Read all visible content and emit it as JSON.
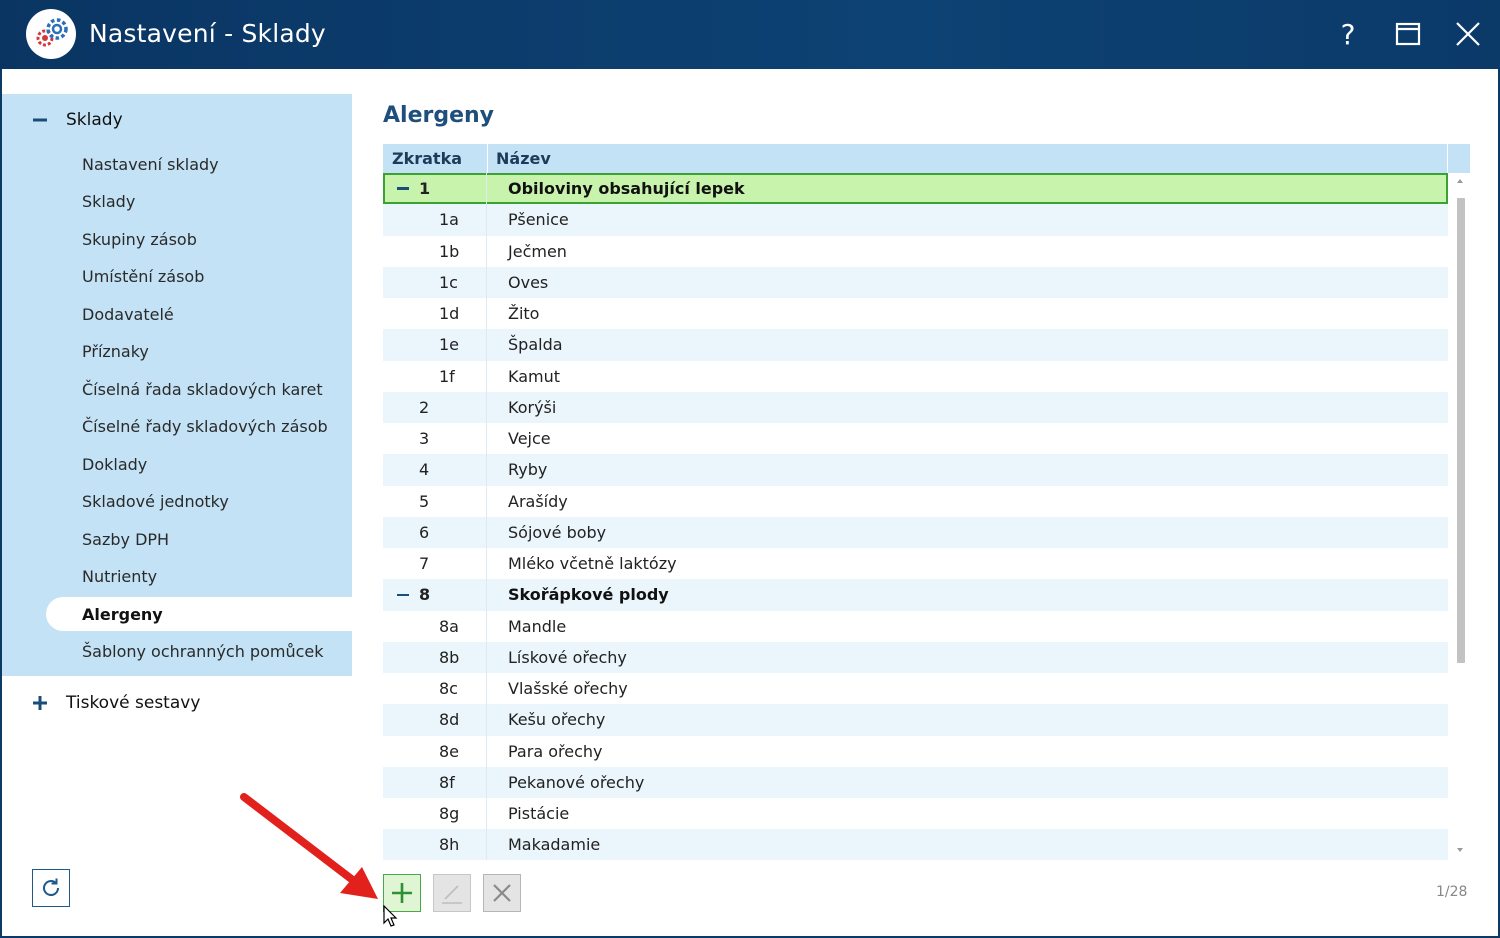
{
  "window": {
    "title": "Nastavení - Sklady",
    "help_label": "?",
    "logo_icon": "gears-icon",
    "accent": "#0b3a66"
  },
  "sidebar": {
    "sections": [
      {
        "label": "Sklady",
        "expanded": true,
        "items": [
          {
            "label": "Nastavení sklady"
          },
          {
            "label": "Sklady"
          },
          {
            "label": "Skupiny zásob"
          },
          {
            "label": "Umístění zásob"
          },
          {
            "label": "Dodavatelé"
          },
          {
            "label": "Příznaky"
          },
          {
            "label": "Číselná řada skladových karet"
          },
          {
            "label": "Číselné řady skladových zásob"
          },
          {
            "label": "Doklady"
          },
          {
            "label": "Skladové jednotky"
          },
          {
            "label": "Sazby DPH"
          },
          {
            "label": "Nutrienty"
          },
          {
            "label": "Alergeny",
            "active": true
          },
          {
            "label": "Šablony ochranných pomůcek"
          }
        ]
      },
      {
        "label": "Tiskové sestavy",
        "expanded": false
      }
    ]
  },
  "main": {
    "title": "Alergeny",
    "columns": {
      "code": "Zkratka",
      "name": "Název"
    },
    "rows": [
      {
        "code": "1",
        "name": "Obiloviny obsahující lepek",
        "type": "group",
        "selected": true
      },
      {
        "code": "1a",
        "name": "Pšenice",
        "type": "child"
      },
      {
        "code": "1b",
        "name": "Ječmen",
        "type": "child"
      },
      {
        "code": "1c",
        "name": "Oves",
        "type": "child"
      },
      {
        "code": "1d",
        "name": "Žito",
        "type": "child"
      },
      {
        "code": "1e",
        "name": "Špalda",
        "type": "child"
      },
      {
        "code": "1f",
        "name": "Kamut",
        "type": "child"
      },
      {
        "code": "2",
        "name": "Korýši",
        "type": "top"
      },
      {
        "code": "3",
        "name": "Vejce",
        "type": "top"
      },
      {
        "code": "4",
        "name": "Ryby",
        "type": "top"
      },
      {
        "code": "5",
        "name": "Arašídy",
        "type": "top"
      },
      {
        "code": "6",
        "name": "Sójové boby",
        "type": "top"
      },
      {
        "code": "7",
        "name": "Mléko včetně laktózy",
        "type": "top"
      },
      {
        "code": "8",
        "name": "Skořápkové plody",
        "type": "group"
      },
      {
        "code": "8a",
        "name": "Mandle",
        "type": "child"
      },
      {
        "code": "8b",
        "name": "Lískové ořechy",
        "type": "child"
      },
      {
        "code": "8c",
        "name": "Vlašské ořechy",
        "type": "child"
      },
      {
        "code": "8d",
        "name": "Kešu ořechy",
        "type": "child"
      },
      {
        "code": "8e",
        "name": "Para ořechy",
        "type": "child"
      },
      {
        "code": "8f",
        "name": "Pekanové ořechy",
        "type": "child"
      },
      {
        "code": "8g",
        "name": "Pistácie",
        "type": "child"
      },
      {
        "code": "8h",
        "name": "Makadamie",
        "type": "child"
      }
    ],
    "record_counter": "1/28",
    "colors": {
      "selected_row": "#c8f3ad",
      "selected_border": "#3aa133",
      "header_bg": "#c3e2f5"
    }
  },
  "toolbar": {
    "add_icon": "plus-icon",
    "edit_icon": "pencil-icon",
    "delete_icon": "x-icon",
    "refresh_icon": "refresh-icon"
  }
}
